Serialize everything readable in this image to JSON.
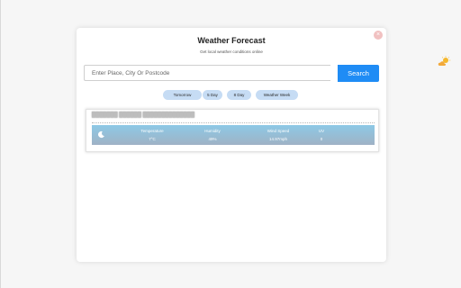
{
  "popup": {
    "title": "Weather Forecast",
    "subtitle": "Get local weather conditions online",
    "close_icon": "×"
  },
  "search": {
    "placeholder": "Enter Place, City Or Postcode",
    "value": "",
    "button_label": "Search"
  },
  "tabs": [
    {
      "label": "Tomorrow"
    },
    {
      "label": "5 Day"
    },
    {
      "label": "8 Day"
    },
    {
      "label": "Weather Week"
    }
  ],
  "result": {
    "location": "███████ ██████ ██████████████",
    "icon": "moon-icon",
    "headers": [
      "Temperature",
      "Humidity",
      "Wind Speed",
      "UV"
    ],
    "values": [
      "7°C",
      "49%",
      "14.97mph",
      "0"
    ]
  },
  "side_icon": "sun-cloud-icon",
  "colors": {
    "accent": "#1f8cf5",
    "pill": "#c6dcf4",
    "row_top": "#8dc9e6",
    "row_bottom": "#9fb2c5"
  }
}
